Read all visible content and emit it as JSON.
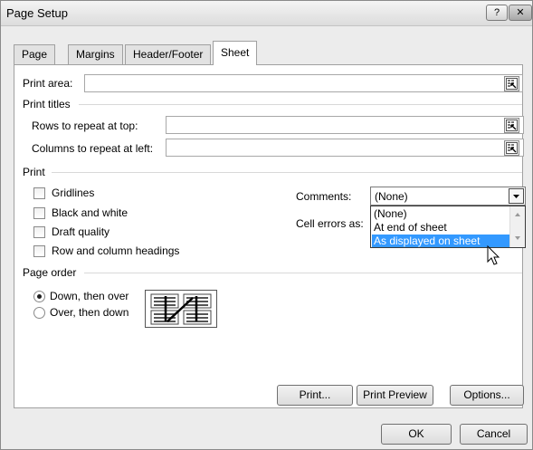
{
  "window": {
    "title": "Page Setup",
    "help_label": "?",
    "close_label": "✕"
  },
  "tabs": [
    {
      "label": "Page",
      "active": false
    },
    {
      "label": "Margins",
      "active": false
    },
    {
      "label": "Header/Footer",
      "active": false
    },
    {
      "label": "Sheet",
      "active": true
    }
  ],
  "print_area": {
    "label": "Print area:",
    "value": ""
  },
  "print_titles": {
    "heading": "Print titles",
    "rows_label": "Rows to repeat at top:",
    "rows_value": "",
    "cols_label": "Columns to repeat at left:",
    "cols_value": ""
  },
  "print": {
    "heading": "Print",
    "checkboxes": [
      {
        "label": "Gridlines",
        "checked": false
      },
      {
        "label": "Black and white",
        "checked": false
      },
      {
        "label": "Draft quality",
        "checked": false
      },
      {
        "label": "Row and column headings",
        "checked": false
      }
    ],
    "comments_label": "Comments:",
    "comments_value": "(None)",
    "cell_errors_label": "Cell errors as:",
    "dropdown_options": [
      "(None)",
      "At end of sheet",
      "As displayed on sheet"
    ],
    "dropdown_highlighted": "As displayed on sheet"
  },
  "page_order": {
    "heading": "Page order",
    "options": [
      {
        "label": "Down, then over",
        "selected": true
      },
      {
        "label": "Over, then down",
        "selected": false
      }
    ]
  },
  "buttons": {
    "print": "Print...",
    "print_preview": "Print Preview",
    "options": "Options...",
    "ok": "OK",
    "cancel": "Cancel"
  },
  "colors": {
    "selection_highlight": "#3399ff",
    "dialog_background": "#ececec",
    "panel_background": "#ffffff"
  },
  "icons": {
    "ref_button": "collapse-dialog-icon",
    "combo_arrow": "chevron-down-icon",
    "cursor": "mouse-pointer-icon"
  }
}
